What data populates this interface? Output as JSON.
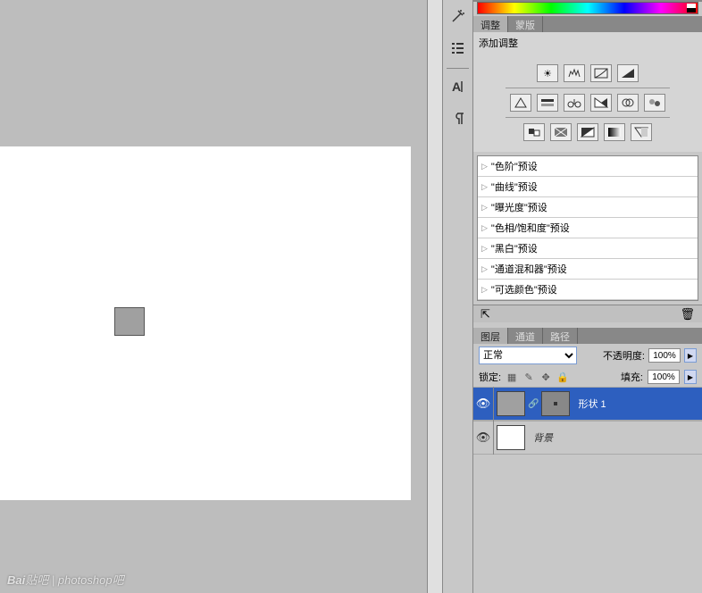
{
  "tabs": {
    "adjustments": "调整",
    "masks": "蒙版"
  },
  "section": {
    "add_adjustment": "添加调整"
  },
  "presets": [
    "\"色阶\"预设",
    "\"曲线\"预设",
    "\"曝光度\"预设",
    "\"色相/饱和度\"预设",
    "\"黑白\"预设",
    "\"通道混和器\"预设",
    "\"可选颜色\"预设"
  ],
  "layer_tabs": {
    "layers": "图层",
    "channels": "通道",
    "paths": "路径"
  },
  "blend": {
    "mode": "正常",
    "opacity_label": "不透明度:",
    "opacity_value": "100%",
    "lock_label": "锁定:",
    "fill_label": "填充:",
    "fill_value": "100%"
  },
  "layers": {
    "shape1": "形状 1",
    "background": "背景"
  },
  "watermark": {
    "brand": "Bai",
    "brand2": "贴吧",
    "sep": " | ",
    "sub": "photoshop吧"
  }
}
